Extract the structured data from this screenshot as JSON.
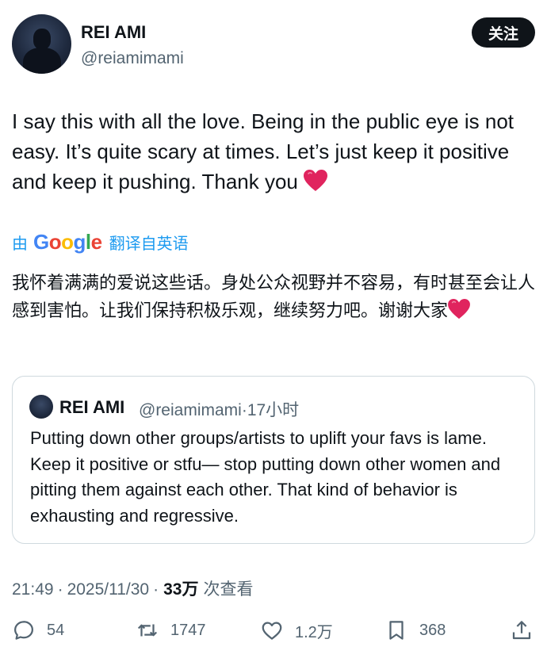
{
  "author": {
    "name": "REI AMI",
    "handle": "@reiamimami",
    "follow_label": "关注"
  },
  "tweet": {
    "text": "I say this with all the love. Being in the public eye is not easy. It’s quite scary at times. Let’s just keep it positive and keep it pushing. Thank you",
    "emoji": "❤️"
  },
  "translation": {
    "by": "由",
    "provider": "Google",
    "label": "翻译自英语",
    "text": "我怀着满满的爱说这些话。身处公众视野并不容易，有时甚至会让人感到害怕。让我们保持积极乐观，继续努力吧。谢谢大家",
    "emoji": "❤️"
  },
  "quoted_tweet": {
    "name": "REI AMI",
    "handle": "@reiamimami",
    "separator": "·",
    "time": "17小时",
    "text": "Putting down other groups/artists to uplift your favs is lame. Keep it positive or stfu— stop putting down other women and pitting them against each other. That kind of behavior is exhausting and regressive."
  },
  "meta": {
    "time": "21:49",
    "separator": "·",
    "date": "2025/11/30",
    "separator2": "·",
    "views": "33万",
    "views_label": "次查看"
  },
  "actions": {
    "replies": "54",
    "retweets": "1747",
    "likes": "1.2万",
    "bookmarks": "368"
  },
  "colors": {
    "text": "#0f1419",
    "secondary": "#536471",
    "link": "#1d9bf0",
    "border": "#cfd9de"
  },
  "icons": [
    "reply-icon",
    "retweet-icon",
    "like-icon",
    "bookmark-icon",
    "share-icon"
  ]
}
